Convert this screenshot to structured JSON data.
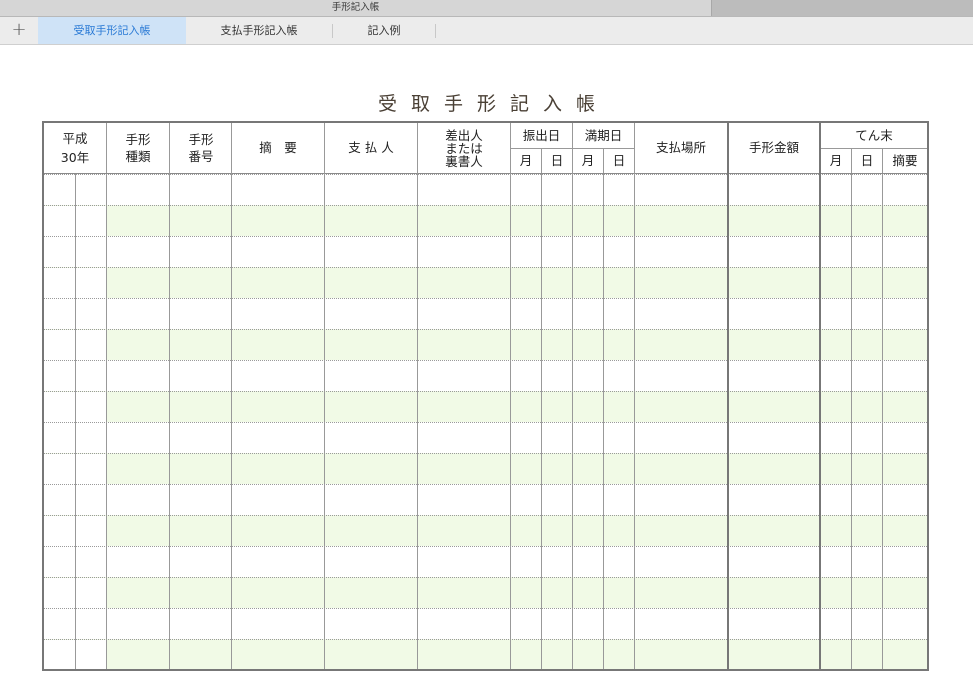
{
  "window": {
    "title": "手形記入帳"
  },
  "tabs": {
    "add_icon": "plus-icon",
    "items": [
      {
        "label": "受取手形記入帳",
        "active": true
      },
      {
        "label": "支払手形記入帳",
        "active": false
      },
      {
        "label": "記入例",
        "active": false
      }
    ]
  },
  "sheet": {
    "heading": "受取手形記入帳",
    "headers": {
      "era": [
        "平成",
        "30年"
      ],
      "note_type": [
        "手形",
        "種類"
      ],
      "note_no": [
        "手形",
        "番号"
      ],
      "summary": "摘　要",
      "payer": "支 払 人",
      "issuer": [
        "差出人",
        "または",
        "裏書人"
      ],
      "issue_date": "振出日",
      "due_date": "満期日",
      "month": "月",
      "day": "日",
      "pay_place": "支払場所",
      "amount": "手形金額",
      "settlement": "てん末",
      "settle_summary": "摘要"
    },
    "row_count": 16,
    "colors": {
      "alt_row": "#f1fae6",
      "active_tab": "#cfe3f7",
      "active_tab_text": "#2a7ad5"
    }
  }
}
